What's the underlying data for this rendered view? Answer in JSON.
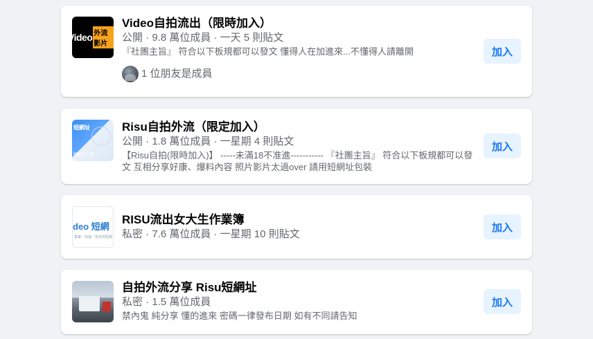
{
  "groups": [
    {
      "thumb": {
        "text_a": "Video",
        "text_b": "外流影片"
      },
      "name": "Video自拍流出（限時加入）",
      "meta": "公開 · 9.8 萬位成員 · 一天 5 則貼文",
      "description": "『社團主旨』 符合以下板規都可以發文 懂得人在加進來...不懂得人請離開",
      "friends": "1 位朋友是成員",
      "join_label": "加入"
    },
    {
      "thumb": {
        "text_a": "短網址",
        "text_b": "短網址 / 網"
      },
      "name": "Risu自拍外流（限定加入）",
      "meta": "公開 · 1.8 萬位成員 · 一星期 4 則貼文",
      "description": "【Risu自拍(限時加入)】 -----未滿18不准進----------- 『社團主旨』 符合以下板規都可以發文 互相分享好康、爆料內容 照片影片太過over 請用短網址包裝",
      "join_label": "加入"
    },
    {
      "thumb": {
        "text_a": "deo 短網",
        "text_b": "專業・快速・安全的短網"
      },
      "name": "RISU流出女大生作業簿",
      "meta": "私密 · 7.6 萬位成員 · 一星期 10 則貼文",
      "join_label": "加入"
    },
    {
      "name": "自拍外流分享 Risu短網址",
      "meta": "私密 · 1.5 萬位成員",
      "description": "禁內鬼 純分享 懂的進來 密碼一律發布日期 如有不同請告知",
      "join_label": "加入"
    }
  ],
  "colors": {
    "background": "#f0f2f5",
    "card": "#ffffff",
    "button_bg": "#e7f3ff",
    "button_text": "#1877f2"
  }
}
